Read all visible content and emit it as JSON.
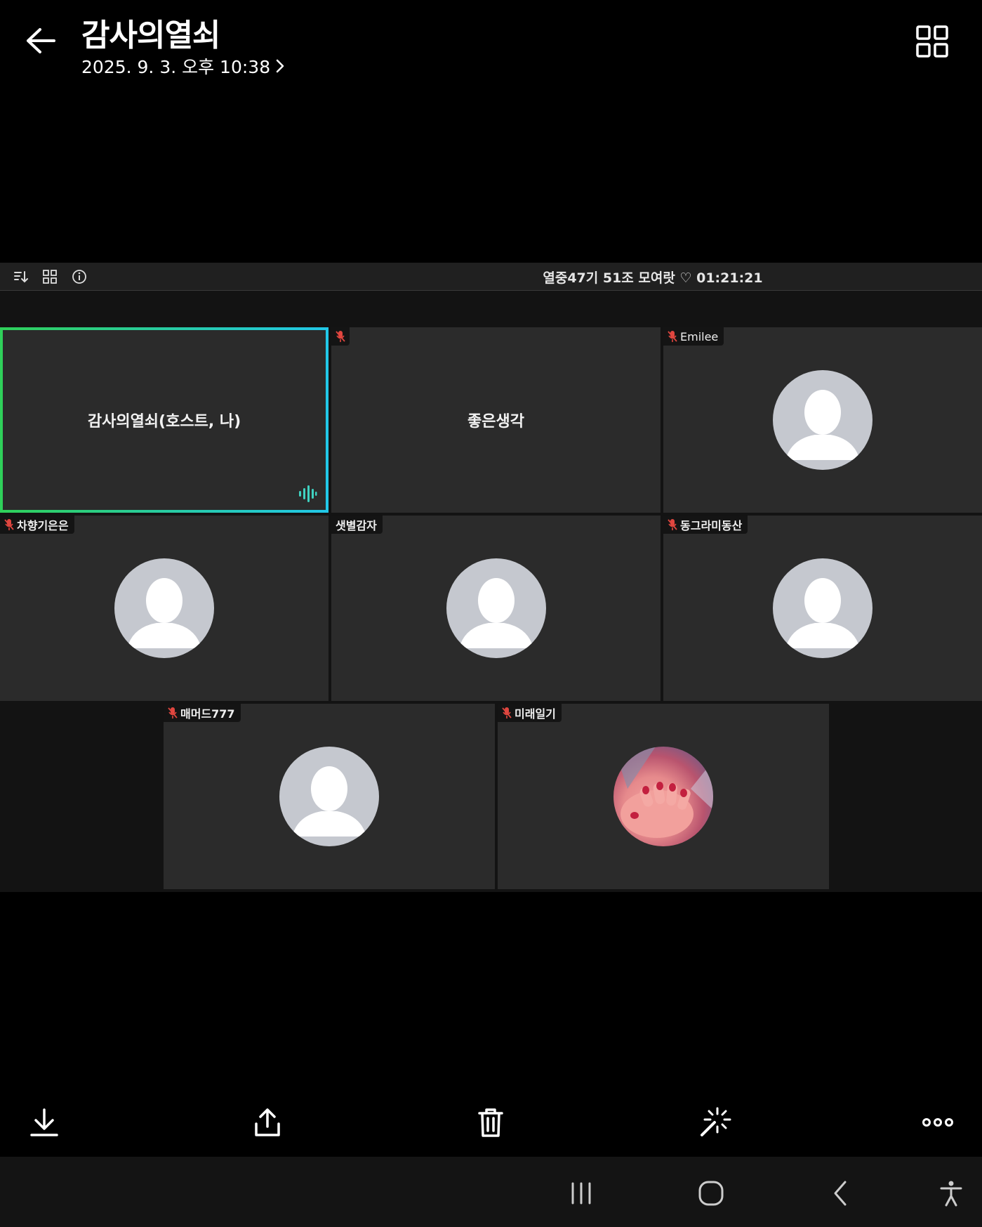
{
  "header": {
    "title": "감사의열쇠",
    "datetime": "2025. 9. 3. 오후 10:38"
  },
  "meeting": {
    "title": "열중47기 51조 모여랏 ♡ 01:21:21",
    "tiles": [
      {
        "name": "감사의열쇠(호스트, 나)",
        "muted": false,
        "speaking": true,
        "avatar": "none"
      },
      {
        "name": "좋은생각",
        "muted": true,
        "avatar": "none"
      },
      {
        "name": "Emilee",
        "muted": true,
        "avatar": "default"
      },
      {
        "name": "차향기은은",
        "muted": true,
        "avatar": "default"
      },
      {
        "name": "샛별감자",
        "muted": false,
        "avatar": "default"
      },
      {
        "name": "동그라미동산",
        "muted": true,
        "avatar": "default"
      },
      {
        "name": "매머드777",
        "muted": true,
        "avatar": "default"
      },
      {
        "name": "미래일기",
        "muted": true,
        "avatar": "photo"
      }
    ]
  },
  "colors": {
    "background": "#000000",
    "tile": "#2b2b2b",
    "active_border_start": "#2fd05a",
    "active_border_end": "#21c8e8",
    "mic_off": "#e0463f",
    "avatar_bg": "#c5c8cf"
  },
  "icons": {
    "back": "arrow-left-icon",
    "layout": "grid-layout-icon",
    "download": "download-icon",
    "share": "share-icon",
    "delete": "trash-icon",
    "edit": "magic-wand-icon",
    "more": "more-dots-icon"
  }
}
